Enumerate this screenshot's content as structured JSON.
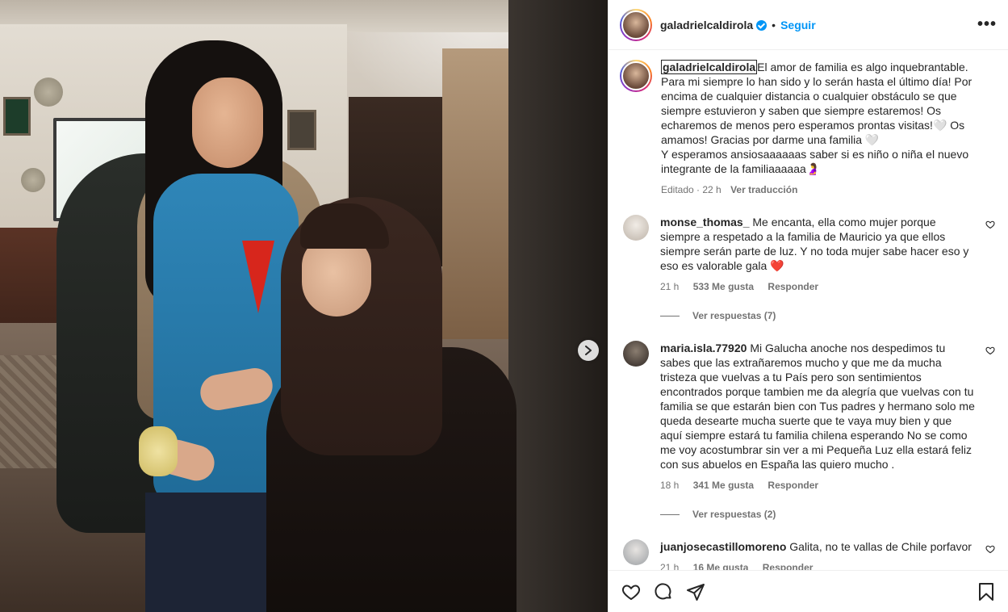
{
  "post": {
    "username": "galadrielcaldirola",
    "follow_label": "Seguir",
    "dot": "•",
    "more": "•••"
  },
  "caption": {
    "username": "galadrielcaldirola",
    "text": "El amor de familia es algo inquebrantable. Para mi siempre lo han sido y lo serán hasta el último día! Por encima de cualquier distancia o cualquier obstáculo se que siempre estuvieron y saben que siempre estaremos! Os echaremos de menos pero esperamos prontas visitas!🤍 Os amamos! Gracias por darme una familia 🤍",
    "text2": "Y esperamos ansiosaaaaaas saber si es niño o niña el nuevo integrante de la familiaaaaaa🤰",
    "edited": "Editado · 22 h",
    "translate": "Ver traducción"
  },
  "comments": [
    {
      "user": "monse_thomas_",
      "text": "Me encanta, ella como mujer porque siempre a respetado a la familia de Mauricio ya que ellos siempre serán parte de luz. Y no toda mujer sabe hacer eso y eso es valorable gala ❤️",
      "time": "21 h",
      "likes": "533 Me gusta",
      "reply": "Responder",
      "view_replies": "Ver respuestas (7)",
      "avatar_color": "#d8d2cc"
    },
    {
      "user": "maria.isla.77920",
      "text": "Mi Galucha anoche nos despedimos tu sabes que las extrañaremos mucho y que me da mucha tristeza que vuelvas a tu País pero son sentimientos encontrados porque tambien me da alegría que vuelvas con tu familia se que estarán bien con Tus padres y hermano solo me queda desearte mucha suerte que te vaya muy bien y que aquí siempre estará tu familia chilena esperando No se como me voy acostumbrar sin ver a mi Pequeña Luz ella estará feliz con sus abuelos en España las quiero mucho .",
      "time": "18 h",
      "likes": "341 Me gusta",
      "reply": "Responder",
      "view_replies": "Ver respuestas (2)",
      "avatar_color": "#5b5048"
    },
    {
      "user": "juanjosecastillomoreno",
      "text": "Galita, no te vallas de Chile porfavor",
      "time": "21 h",
      "likes": "16 Me gusta",
      "reply": "Responder",
      "view_replies": "",
      "avatar_color": "#c9cbcc"
    }
  ],
  "icons": {
    "like": "heart-icon",
    "comment": "comment-icon",
    "share": "share-icon",
    "save": "bookmark-icon",
    "next": "chevron-right-icon"
  },
  "colors": {
    "accent": "#0095f6",
    "text": "#262626",
    "muted": "#737373",
    "red_heart": "#e0243a"
  }
}
